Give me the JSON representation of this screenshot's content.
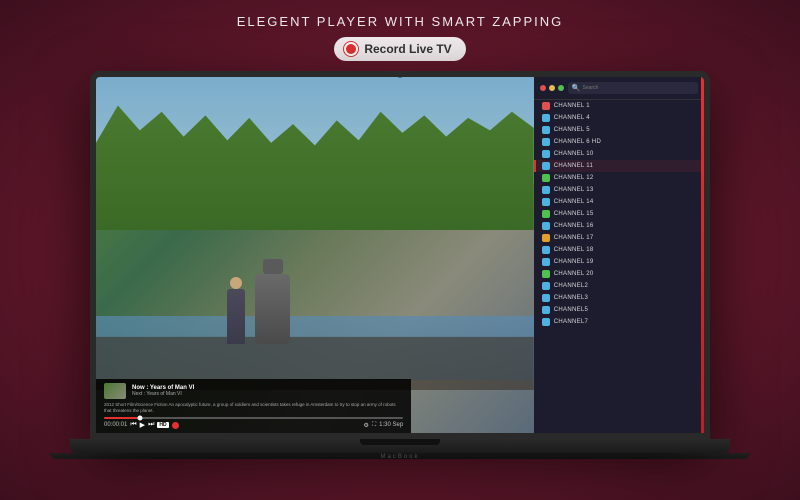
{
  "header": {
    "title": "ELEGENT PLAYER WITH SMART ZAPPING",
    "record_button": "Record Live TV"
  },
  "player": {
    "show_title": "Now : Years of Man VI",
    "show_subtitle": "Next : Years of Man VI",
    "description": "2012 Short Film/Science Fiction An apocalyptic future, a group of soldiers and scientists takes refuge in Amsterdam to try to stop an army of robots that threatens the planet.",
    "time_current": "00:00:01",
    "time_total": "1:30 Sep",
    "seek_percent": 12,
    "hd_label": "HD",
    "search_placeholder": "Search"
  },
  "channels": [
    {
      "name": "CHANNEL 1",
      "color": "#e05050",
      "active": false
    },
    {
      "name": "CHANNEL 4",
      "color": "#50b0e0",
      "active": false
    },
    {
      "name": "CHANNEL 5",
      "color": "#50b0e0",
      "active": false
    },
    {
      "name": "CHANNEL 6 HD",
      "color": "#50b0e0",
      "active": false
    },
    {
      "name": "CHANNEL 10",
      "color": "#50b0e0",
      "active": false
    },
    {
      "name": "CHANNEL 11",
      "color": "#50b0e0",
      "active": true
    },
    {
      "name": "CHANNEL 12",
      "color": "#50c050",
      "active": false
    },
    {
      "name": "CHANNEL 13",
      "color": "#50b0e0",
      "active": false
    },
    {
      "name": "CHANNEL 14",
      "color": "#50b0e0",
      "active": false
    },
    {
      "name": "CHANNEL 15",
      "color": "#50c050",
      "active": false
    },
    {
      "name": "CHANNEL 16",
      "color": "#50b0e0",
      "active": false
    },
    {
      "name": "CHANNEL 17",
      "color": "#e0a030",
      "active": false
    },
    {
      "name": "CHANNEL 18",
      "color": "#50b0e0",
      "active": false
    },
    {
      "name": "CHANNEL 19",
      "color": "#50b0e0",
      "active": false
    },
    {
      "name": "CHANNEL 20",
      "color": "#50c050",
      "active": false
    },
    {
      "name": "CHANNEL2",
      "color": "#50b0e0",
      "active": false
    },
    {
      "name": "CHANNEL3",
      "color": "#50b0e0",
      "active": false
    },
    {
      "name": "CHANNEL5",
      "color": "#50b0e0",
      "active": false
    },
    {
      "name": "CHANNEL7",
      "color": "#50b0e0",
      "active": false
    }
  ],
  "macbook_label": "MacBook"
}
